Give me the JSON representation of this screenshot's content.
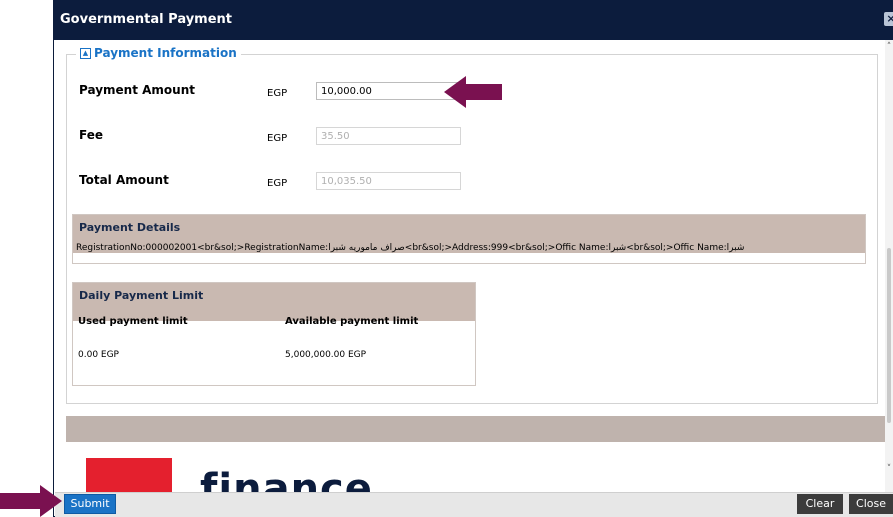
{
  "dialog": {
    "title": "Governmental Payment"
  },
  "payment_info": {
    "legend": "Payment Information",
    "fields": [
      {
        "label": "Payment Amount",
        "currency": "EGP",
        "value": "10,000.00"
      },
      {
        "label": "Fee",
        "currency": "EGP",
        "value": "35.50"
      },
      {
        "label": "Total Amount",
        "currency": "EGP",
        "value": "10,035.50"
      }
    ]
  },
  "payment_details": {
    "header": "Payment Details",
    "text": "RegistrationNo:000002001<br&sol;>RegistrationName:صراف مأموريه شبرا<br&sol;>Address:999<br&sol;>Offic Name:شبرا<br&sol;>Offic Name:شبرا"
  },
  "daily_limit": {
    "header": "Daily Payment Limit",
    "used_label": "Used payment limit",
    "available_label": "Available payment limit",
    "used_value": "0.00 EGP",
    "available_value": "5,000,000.00 EGP"
  },
  "branding": {
    "logo_text": "finance"
  },
  "buttons": {
    "submit": "Submit",
    "clear": "Clear",
    "close": "Close"
  },
  "colors": {
    "title_bar": "#0c1c3d",
    "accent": "#1a73c6",
    "annotation_arrow": "#7a1150",
    "panel_header": "#c9b9b1"
  }
}
